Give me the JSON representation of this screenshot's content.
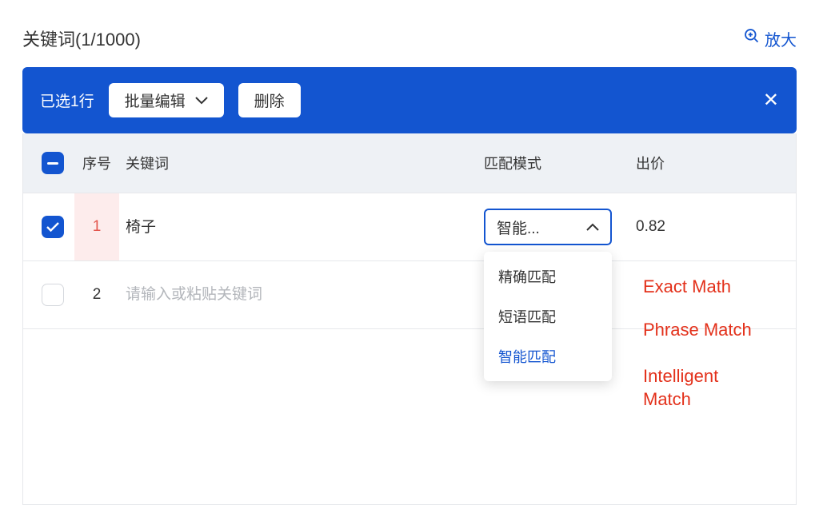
{
  "header": {
    "title": "关键词(1/1000)",
    "enlarge_label": "放大"
  },
  "action_bar": {
    "selected_text": "已选1行",
    "batch_edit_label": "批量编辑",
    "delete_label": "删除"
  },
  "columns": {
    "index": "序号",
    "keyword": "关键词",
    "match_mode": "匹配模式",
    "bid": "出价"
  },
  "rows": [
    {
      "checked": true,
      "index": "1",
      "keyword": "椅子",
      "mode_display": "智能...",
      "bid": "0.82"
    },
    {
      "checked": false,
      "index": "2",
      "keyword_placeholder": "请输入或粘贴关键词",
      "mode_display": "",
      "bid": ""
    }
  ],
  "dropdown_options": [
    {
      "label": "精确匹配",
      "active": false
    },
    {
      "label": "短语匹配",
      "active": false
    },
    {
      "label": "智能匹配",
      "active": true
    }
  ],
  "annotations": {
    "exact": "Exact Math",
    "phrase": "Phrase Match",
    "intelligent": "Intelligent Match"
  }
}
